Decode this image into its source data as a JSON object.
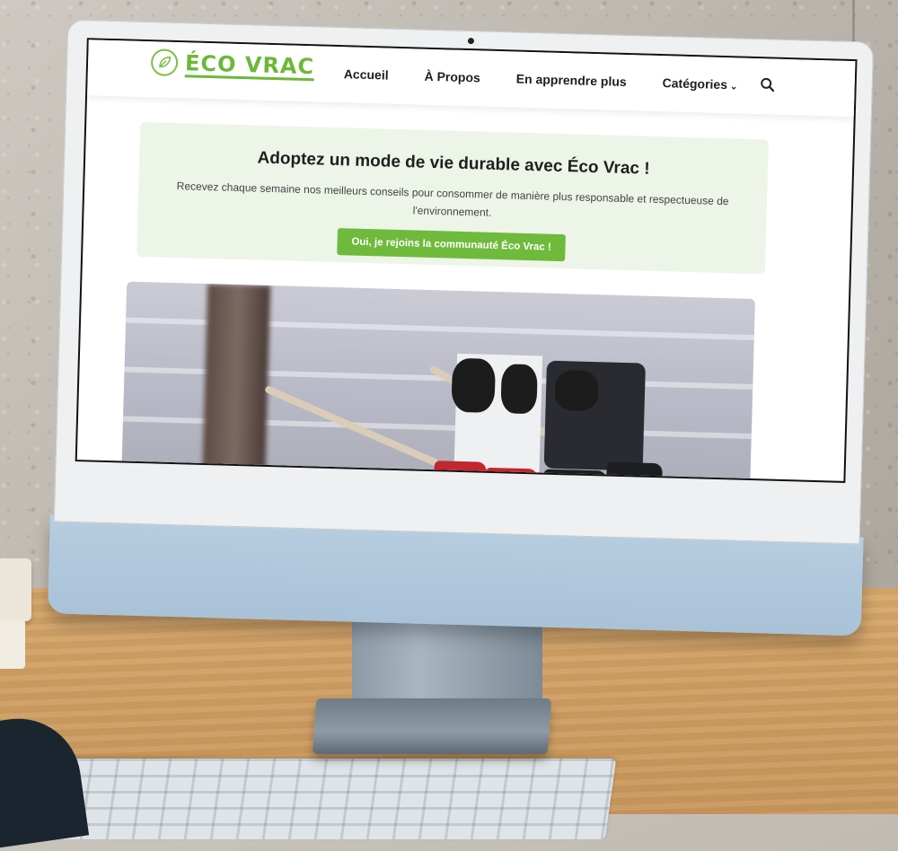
{
  "site": {
    "logo_text": "ÉCO VRAC",
    "accent_color": "#6fba3c",
    "nav": [
      {
        "label": "Accueil"
      },
      {
        "label": "À Propos"
      },
      {
        "label": "En apprendre plus"
      },
      {
        "label": "Catégories",
        "has_dropdown": true
      }
    ],
    "search_icon": "search-icon"
  },
  "banner": {
    "title": "Adoptez un mode de vie durable avec Éco Vrac !",
    "text": "Recevez chaque semaine nos meilleurs conseils pour consommer de manière plus responsable et respectueuse de l'environnement.",
    "cta_label": "Oui, je rejoins la communauté Éco Vrac !",
    "background_color": "#edf5e8"
  }
}
